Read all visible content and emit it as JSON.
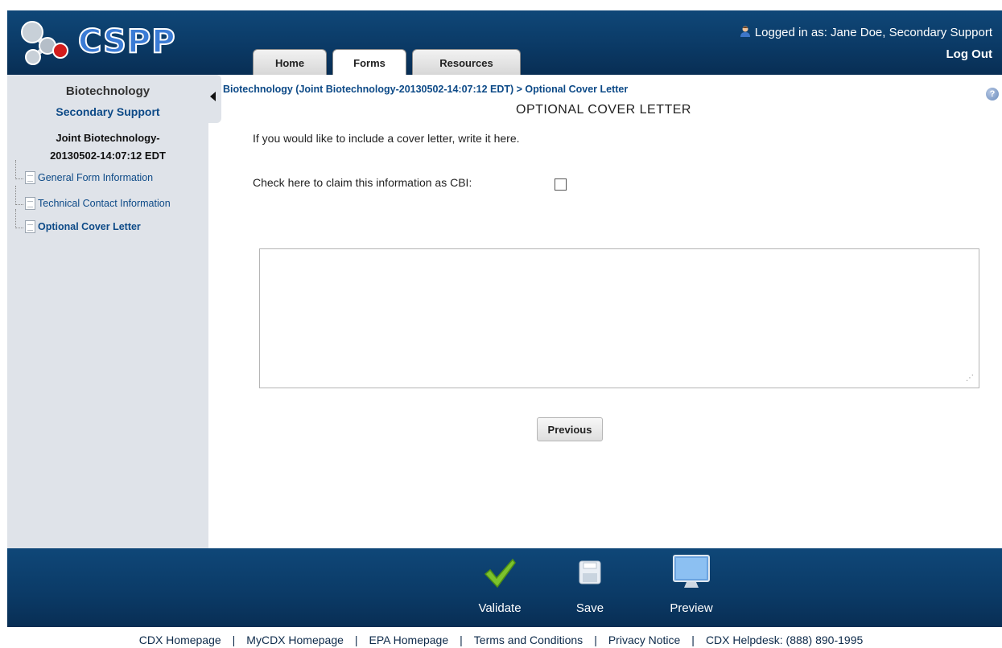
{
  "app": {
    "logo_text": "CSPP"
  },
  "tabs": [
    {
      "label": "Home"
    },
    {
      "label": "Forms"
    },
    {
      "label": "Resources"
    }
  ],
  "user": {
    "logged_in_text": "Logged in as: Jane Doe, Secondary Support",
    "logout_label": "Log Out"
  },
  "sidebar": {
    "title": "Biotechnology",
    "role": "Secondary Support",
    "submission_line1": "Joint Biotechnology-",
    "submission_line2": "20130502-14:07:12 EDT",
    "items": [
      {
        "label": "General Form Information"
      },
      {
        "label": "Technical Contact Information"
      },
      {
        "label": "Optional Cover Letter"
      }
    ]
  },
  "main": {
    "breadcrumb": "Biotechnology (Joint Biotechnology-20130502-14:07:12 EDT) > Optional Cover Letter",
    "help_glyph": "?",
    "title": "OPTIONAL COVER LETTER",
    "intro": "If you would like to include a cover letter, write it here.",
    "cbi_label": "Check here to claim this information as CBI:",
    "cbi_checked": false,
    "cover_letter_value": "",
    "previous_label": "Previous"
  },
  "actions": {
    "validate_label": "Validate",
    "save_label": "Save",
    "preview_label": "Preview"
  },
  "footer": {
    "links": [
      {
        "label": "CDX Homepage"
      },
      {
        "label": "MyCDX Homepage"
      },
      {
        "label": "EPA Homepage"
      },
      {
        "label": "Terms and Conditions"
      },
      {
        "label": "Privacy Notice"
      },
      {
        "label": "CDX Helpdesk: (888) 890-1995"
      }
    ],
    "separator": "|"
  },
  "colors": {
    "header_bg": "#0b3a66",
    "sidebar_bg": "#dfe3e9",
    "link_blue": "#0d4a87",
    "validate_green": "#7cc22c"
  }
}
